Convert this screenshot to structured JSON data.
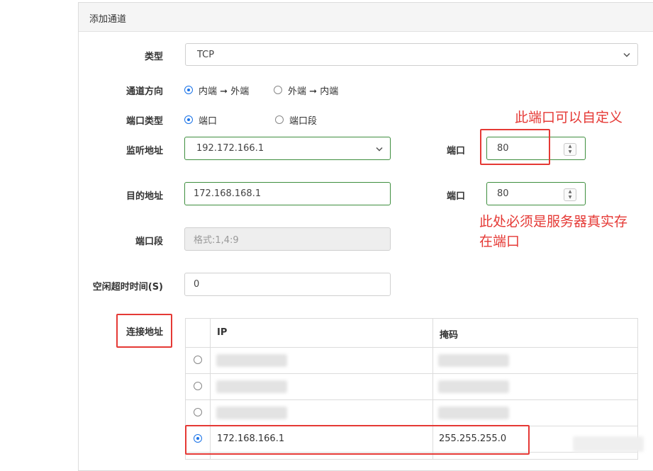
{
  "panel": {
    "title": "添加通道"
  },
  "form": {
    "type": {
      "label": "类型",
      "value": "TCP"
    },
    "direction": {
      "label": "通道方向",
      "option1": {
        "from": "内端",
        "arrow": "➞",
        "to": "外端",
        "selected": true
      },
      "option2": {
        "from": "外端",
        "arrow": "➞",
        "to": "内端",
        "selected": false
      }
    },
    "port_type": {
      "label": "端口类型",
      "option1": {
        "label": "端口",
        "selected": true
      },
      "option2": {
        "label": "端口段",
        "selected": false
      }
    },
    "listen_address": {
      "label": "监听地址",
      "value": "192.172.166.1",
      "port_label": "端口",
      "port_value": "80"
    },
    "target_address": {
      "label": "目的地址",
      "value": "172.168.168.1",
      "port_label": "端口",
      "port_value": "80"
    },
    "port_range": {
      "label": "端口段",
      "placeholder": "格式:1,4:9"
    },
    "idle_timeout": {
      "label": "空闲超时时间(S)",
      "value": "0"
    },
    "connection": {
      "label": "连接地址",
      "columns": [
        "IP",
        "掩码"
      ],
      "rows": [
        {
          "ip": "",
          "mask": "",
          "selected": false,
          "blurred": true
        },
        {
          "ip": "",
          "mask": "",
          "selected": false,
          "blurred": true
        },
        {
          "ip": "",
          "mask": "",
          "selected": false,
          "blurred": true
        },
        {
          "ip": "172.168.166.1",
          "mask": "255.255.255.0",
          "selected": true,
          "blurred": false
        }
      ]
    }
  },
  "annotations": {
    "note1": "此端口可以自定义",
    "note2_line1": "此处必须是服务器真实存",
    "note2_line2": "在端口",
    "color": "#e53935"
  },
  "colors": {
    "accent": "#1a73e8",
    "field_border": "#3e8e3e"
  },
  "icons": {
    "select": "chevron-down-icon",
    "spinner": "spinner-icon"
  }
}
